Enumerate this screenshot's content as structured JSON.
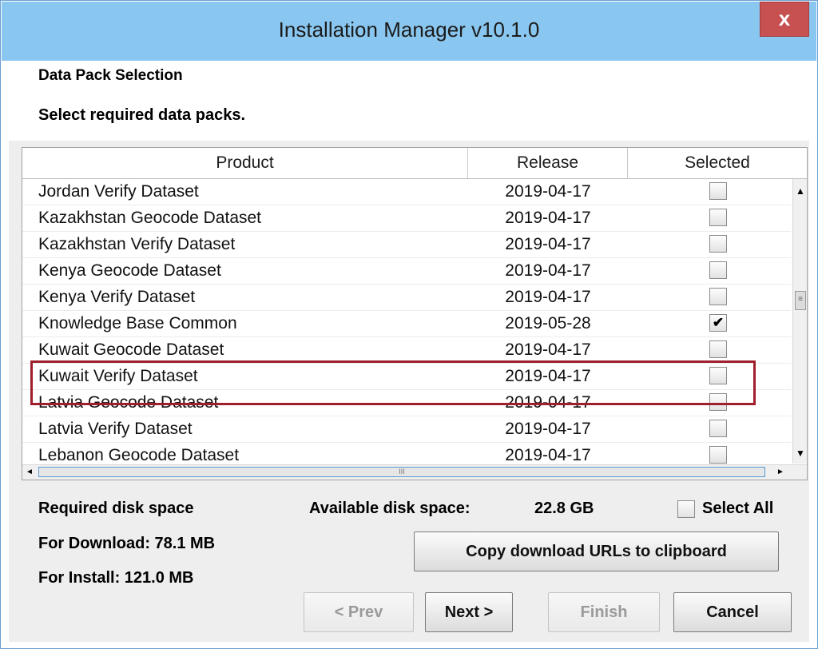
{
  "window": {
    "title": "Installation Manager v10.1.0",
    "close_label": "x"
  },
  "header": {
    "title": "Data Pack Selection",
    "subtitle": "Select required data packs."
  },
  "table": {
    "columns": [
      "Product",
      "Release",
      "Selected"
    ],
    "rows": [
      {
        "product": "Jordan Verify Dataset",
        "release": "2019-04-17",
        "selected": false
      },
      {
        "product": "Kazakhstan Geocode Dataset",
        "release": "2019-04-17",
        "selected": false
      },
      {
        "product": "Kazakhstan Verify Dataset",
        "release": "2019-04-17",
        "selected": false
      },
      {
        "product": "Kenya Geocode Dataset",
        "release": "2019-04-17",
        "selected": false
      },
      {
        "product": "Kenya Verify Dataset",
        "release": "2019-04-17",
        "selected": false
      },
      {
        "product": "Knowledge Base Common",
        "release": "2019-05-28",
        "selected": true
      },
      {
        "product": "Kuwait Geocode Dataset",
        "release": "2019-04-17",
        "selected": false
      },
      {
        "product": "Kuwait Verify Dataset",
        "release": "2019-04-17",
        "selected": false
      },
      {
        "product": "Latvia Geocode Dataset",
        "release": "2019-04-17",
        "selected": false
      },
      {
        "product": "Latvia Verify Dataset",
        "release": "2019-04-17",
        "selected": false
      },
      {
        "product": "Lebanon Geocode Dataset",
        "release": "2019-04-17",
        "selected": false
      }
    ]
  },
  "disk": {
    "required_label": "Required disk space",
    "available_label": "Available disk space:",
    "available_value": "22.8 GB",
    "download_label": "For Download: 78.1 MB",
    "install_label": "For Install: 121.0 MB"
  },
  "select_all_label": "Select All",
  "buttons": {
    "copy_urls": "Copy download URLs to clipboard",
    "prev": "< Prev",
    "next": "Next >",
    "finish": "Finish",
    "cancel": "Cancel"
  },
  "icons": {
    "checkmark": "✔",
    "scroll_up": "▲",
    "scroll_down": "▼",
    "scroll_left": "◄",
    "scroll_right": "►",
    "thumb_grip_v": "≡",
    "thumb_grip_h": "III"
  },
  "colors": {
    "titlebar": "#8ac7f0",
    "close": "#c75050",
    "highlight": "#a01f2d"
  }
}
